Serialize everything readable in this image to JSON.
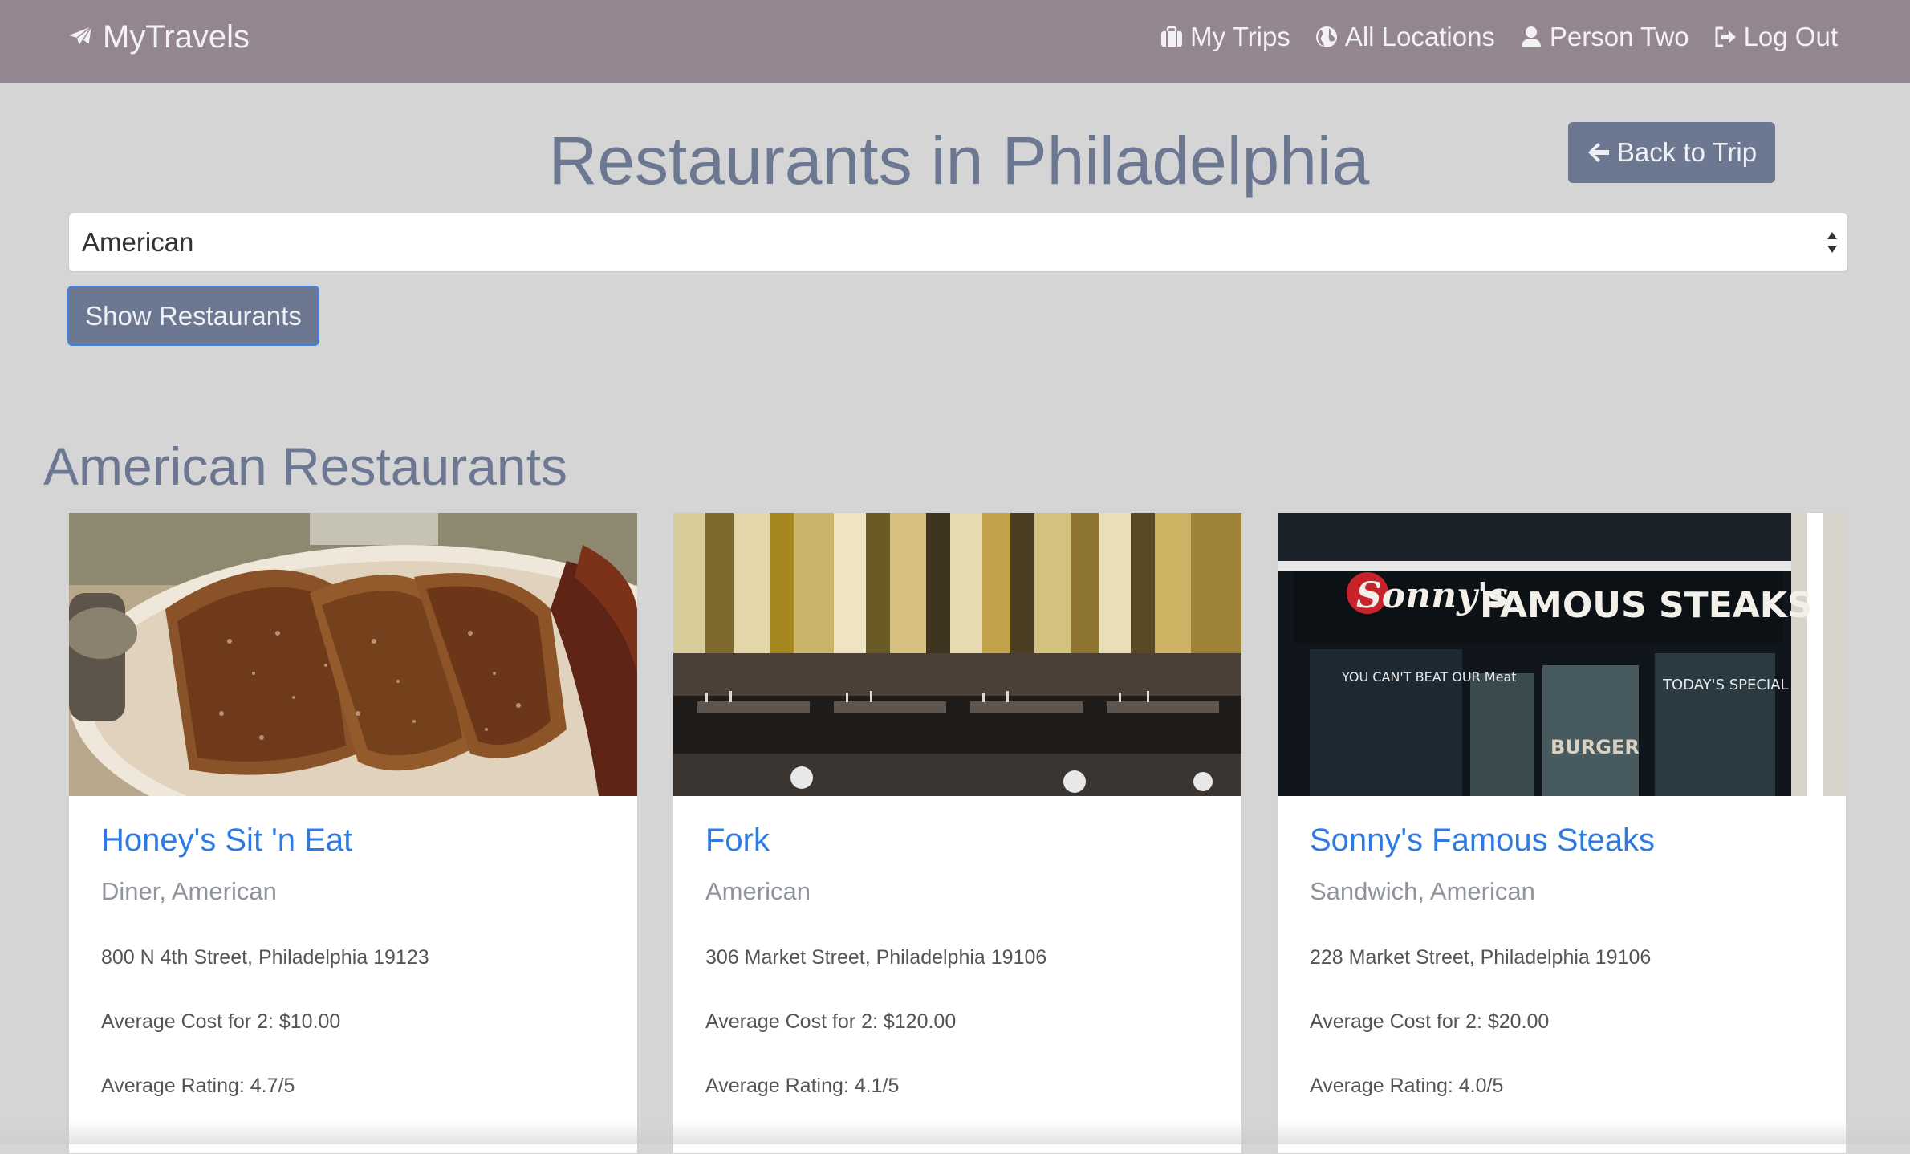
{
  "navbar": {
    "brand": "MyTravels",
    "links": [
      {
        "label": "My Trips",
        "icon": "suitcase-icon"
      },
      {
        "label": "All Locations",
        "icon": "globe-icon"
      },
      {
        "label": "Person Two",
        "icon": "user-icon"
      },
      {
        "label": "Log Out",
        "icon": "logout-icon"
      }
    ]
  },
  "header": {
    "title": "Restaurants in Philadelphia",
    "back_label": "Back to Trip"
  },
  "filter": {
    "selected_cuisine": "American",
    "show_label": "Show Restaurants"
  },
  "results": {
    "section_title": "American Restaurants",
    "cards": [
      {
        "name": "Honey's Sit 'n Eat",
        "cuisine": "Diner, American",
        "address": "800 N 4th Street, Philadelphia 19123",
        "cost": "Average Cost for 2: $10.00",
        "rating": "Average Rating: 4.7/5",
        "image": "french-toast-photo"
      },
      {
        "name": "Fork",
        "cuisine": "American",
        "address": "306 Market Street, Philadelphia 19106",
        "cost": "Average Cost for 2: $120.00",
        "rating": "Average Rating: 4.1/5",
        "image": "dining-room-photo"
      },
      {
        "name": "Sonny's Famous Steaks",
        "cuisine": "Sandwich, American",
        "address": "228 Market Street, Philadelphia 19106",
        "cost": "Average Cost for 2: $20.00",
        "rating": "Average Rating: 4.0/5",
        "image": "storefront-photo",
        "image_text": {
          "logo": "Sonny's",
          "sign": "FAMOUS STEAKS",
          "window_left": "YOU CAN'T BEAT OUR Meat",
          "window_right": "TODAY'S SPECIAL",
          "door": "BURGER"
        }
      }
    ]
  },
  "colors": {
    "navbar": "#938690",
    "background": "#d5d5d5",
    "accent": "#6c7791",
    "link": "#2e7ae3"
  }
}
